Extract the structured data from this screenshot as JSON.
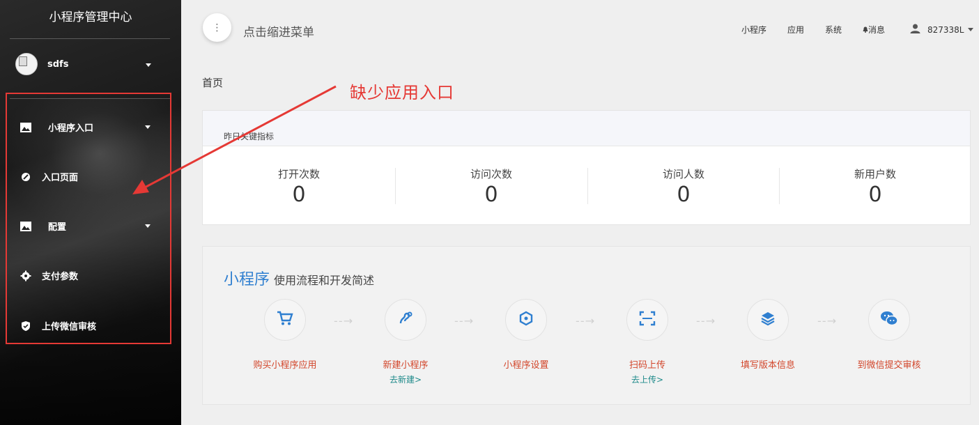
{
  "sidebar": {
    "brand": "小程序管理中心",
    "user": {
      "name": "sdfs"
    },
    "items": [
      {
        "label": "小程序入口",
        "icon": "image-icon",
        "has_caret": true
      },
      {
        "label": "入口页面",
        "icon": "link-icon",
        "has_caret": false
      },
      {
        "label": "配置",
        "icon": "image-icon",
        "has_caret": true
      },
      {
        "label": "支付参数",
        "icon": "gear-icon",
        "has_caret": false
      },
      {
        "label": "上传微信审核",
        "icon": "shield-icon",
        "has_caret": false
      }
    ]
  },
  "topbar": {
    "toggle_label": "点击缩进菜单",
    "nav": [
      "小程序",
      "应用",
      "系统",
      "消息"
    ],
    "account": "827338L"
  },
  "breadcrumb": "首页",
  "annotation": "缺少应用入口",
  "metrics": {
    "title": "昨日关键指标",
    "items": [
      {
        "label": "打开次数",
        "value": "0"
      },
      {
        "label": "访问次数",
        "value": "0"
      },
      {
        "label": "访问人数",
        "value": "0"
      },
      {
        "label": "新用户数",
        "value": "0"
      }
    ]
  },
  "process": {
    "title_main": "小程序",
    "title_sub": "使用流程和开发简述",
    "steps": [
      {
        "label": "购买小程序应用",
        "link": "",
        "icon": "cart-icon"
      },
      {
        "label": "新建小程序",
        "link": "去新建>",
        "icon": "link-chain-icon"
      },
      {
        "label": "小程序设置",
        "link": "",
        "icon": "hexagon-icon"
      },
      {
        "label": "扫码上传",
        "link": "去上传>",
        "icon": "scan-icon"
      },
      {
        "label": "填写版本信息",
        "link": "",
        "icon": "layers-icon"
      },
      {
        "label": "到微信提交审核",
        "link": "",
        "icon": "wechat-icon"
      }
    ]
  },
  "colors": {
    "annotation": "#e53935",
    "accent": "#2f7fd0",
    "step_label": "#d2462b",
    "step_link": "#1f8a8a"
  }
}
